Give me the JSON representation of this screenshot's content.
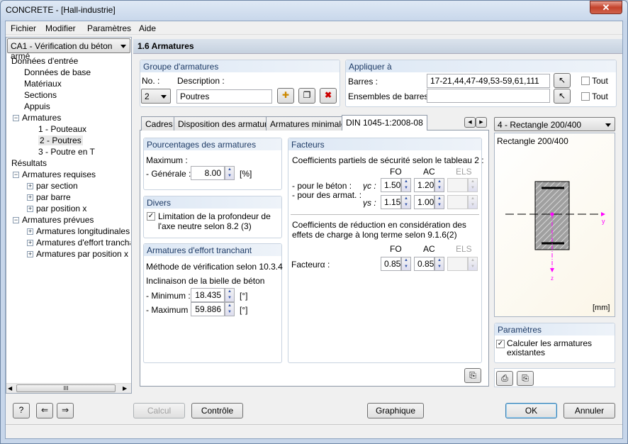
{
  "window": {
    "title": "CONCRETE - [Hall-industrie]",
    "close_label": "✕"
  },
  "menu": [
    "Fichier",
    "Modifier",
    "Paramètres",
    "Aide"
  ],
  "sidebar": {
    "case_select": "CA1 - Vérification du béton armé",
    "tree": [
      {
        "label": "Données d'entrée",
        "level": 0
      },
      {
        "label": "Données de base",
        "level": 1
      },
      {
        "label": "Matériaux",
        "level": 1
      },
      {
        "label": "Sections",
        "level": 1
      },
      {
        "label": "Appuis",
        "level": 1
      },
      {
        "label": "Armatures",
        "level": 1,
        "expander": "−"
      },
      {
        "label": "1 - Pouteaux",
        "level": 2
      },
      {
        "label": "2 - Poutres",
        "level": 2,
        "selected": true
      },
      {
        "label": "3 - Poutre en T",
        "level": 2
      },
      {
        "label": "Résultats",
        "level": 0
      },
      {
        "label": "Armatures requises",
        "level": 1,
        "expander": "−"
      },
      {
        "label": "par section",
        "level": 2,
        "expander": "+"
      },
      {
        "label": "par barre",
        "level": 2,
        "expander": "+"
      },
      {
        "label": "par position x",
        "level": 2,
        "expander": "+"
      },
      {
        "label": "Armatures prévues",
        "level": 1,
        "expander": "−"
      },
      {
        "label": "Armatures longitudinales",
        "level": 2,
        "expander": "+"
      },
      {
        "label": "Armatures d'effort tranchant",
        "level": 2,
        "expander": "+"
      },
      {
        "label": "Armatures par position x",
        "level": 2,
        "expander": "+"
      }
    ],
    "scroll_grip": "III"
  },
  "header": {
    "title": "1.6 Armatures"
  },
  "group": {
    "title": "Groupe d'armatures",
    "no_label": "No. :",
    "no_value": "2",
    "desc_label": "Description :",
    "desc_value": "Poutres"
  },
  "apply": {
    "title": "Appliquer à",
    "bars_label": "Barres :",
    "bars_value": "17-21,44,47-49,53-59,61,111",
    "sets_label": "Ensembles de barres :",
    "sets_value": "",
    "all_label": "Tout",
    "all2_label": "Tout"
  },
  "tabs": [
    {
      "label": "Cadres"
    },
    {
      "label": "Disposition des armatures"
    },
    {
      "label": "Armatures minimales"
    },
    {
      "label": "DIN 1045-1:2008-08",
      "active": true
    }
  ],
  "percent": {
    "title": "Pourcentages des armatures",
    "max_label": "Maximum :",
    "general_label": "- Générale :",
    "general_value": "8.00",
    "unit": "[%]"
  },
  "divers": {
    "title": "Divers",
    "checkbox_label": "Limitation de la profondeur de l'axe neutre selon 8.2 (3)",
    "checked": true
  },
  "shear": {
    "title": "Armatures d'effort tranchant",
    "method": "Méthode de vérification selon 10.3.4",
    "incl_label": "Inclinaison de la bielle de béton",
    "min_label": "- Minimum :",
    "min_value": "18.435",
    "max_label": "- Maximum :",
    "max_value": "59.886",
    "unit": "[°]"
  },
  "factors": {
    "title": "Facteurs",
    "partial_title": "Coefficients partiels de sécurité selon le tableau 2 :",
    "cols": [
      "FO",
      "AC",
      "ELS"
    ],
    "concrete_label": "- pour le béton :",
    "steel_label": "- pour des armat. :",
    "gc_sym": "γc :",
    "gs_sym": "γs :",
    "gc": [
      "1.50",
      "1.20"
    ],
    "gs": [
      "1.15",
      "1.00"
    ],
    "reduction_title": "Coefficients de réduction en considération des effets de charge à long terme selon 9.1.6(2)",
    "alpha_label": "Facteurα :",
    "alpha": [
      "0.85",
      "0.85"
    ]
  },
  "section": {
    "select": "4 - Rectangle 200/400",
    "name": "Rectangle 200/400",
    "unit": "[mm]",
    "axis_y": "y",
    "axis_z": "z",
    "accent": "#ff00ff"
  },
  "params": {
    "title": "Paramètres",
    "checkbox_label": "Calculer les armatures existantes",
    "checked": true
  },
  "footer": {
    "calcul": "Calcul",
    "controle": "Contrôle",
    "graphique": "Graphique",
    "ok": "OK",
    "annuler": "Annuler"
  }
}
